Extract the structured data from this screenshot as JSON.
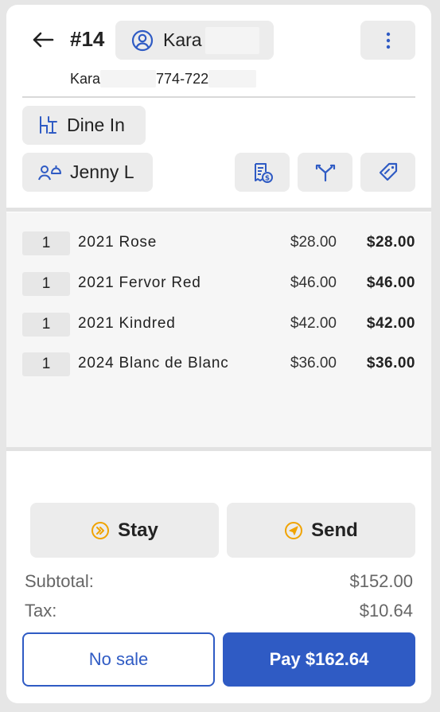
{
  "header": {
    "order_number": "#14",
    "customer_name": "Kara",
    "customer_sub_name": "Kara",
    "customer_phone_partial": "774-722"
  },
  "order_type": {
    "label": "Dine In"
  },
  "server": {
    "label": "Jenny L"
  },
  "icons": {
    "back": "arrow-left-icon",
    "customer": "user-circle-icon",
    "more": "more-vertical-icon",
    "order_type": "dine-in-icon",
    "server": "staff-icon",
    "receipt": "receipt-dollar-icon",
    "split": "split-icon",
    "discount": "tag-icon",
    "stay": "fast-forward-icon",
    "send": "send-icon"
  },
  "items": [
    {
      "qty": "1",
      "name": "2021 Rose",
      "price": "$28.00",
      "total": "$28.00"
    },
    {
      "qty": "1",
      "name": "2021 Fervor Red",
      "price": "$46.00",
      "total": "$46.00"
    },
    {
      "qty": "1",
      "name": "2021 Kindred",
      "price": "$42.00",
      "total": "$42.00"
    },
    {
      "qty": "1",
      "name": "2024 Blanc de Blanc",
      "price": "$36.00",
      "total": "$36.00"
    }
  ],
  "actions": {
    "stay_label": "Stay",
    "send_label": "Send"
  },
  "totals": {
    "subtotal_label": "Subtotal:",
    "subtotal_value": "$152.00",
    "tax_label": "Tax:",
    "tax_value": "$10.64"
  },
  "footer": {
    "no_sale_label": "No sale",
    "pay_label": "Pay $162.64"
  },
  "colors": {
    "accent": "#2f5bc4",
    "icon_orange": "#f0a300",
    "button_bg": "#ececec"
  }
}
